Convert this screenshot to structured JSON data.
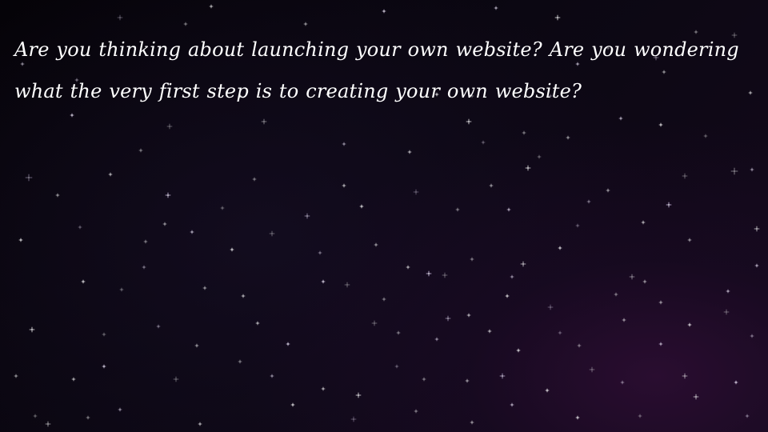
{
  "slide": {
    "text": "Are you thinking about launching your own website? Are you wondering what the very first step is to creating your own website?"
  },
  "background": {
    "base_color": "#07040c",
    "accent_color": "#2e0e34",
    "star_color": "#ffffff",
    "star_glow_color": "#e8d9ff"
  }
}
